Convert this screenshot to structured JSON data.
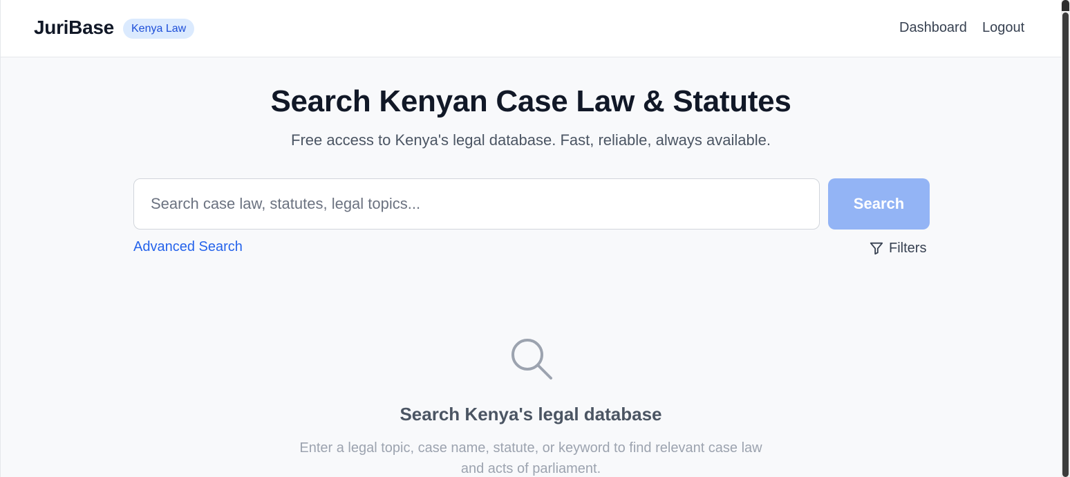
{
  "header": {
    "brand": "JuriBase",
    "badge": "Kenya Law",
    "nav": {
      "dashboard": "Dashboard",
      "logout": "Logout"
    }
  },
  "hero": {
    "title": "Search Kenyan Case Law & Statutes",
    "subtitle": "Free access to Kenya's legal database. Fast, reliable, always available."
  },
  "search": {
    "placeholder": "Search case law, statutes, legal topics...",
    "value": "",
    "button_label": "Search",
    "button_color": "#93b4f5",
    "advanced_label": "Advanced Search",
    "filters_label": "Filters",
    "filters_icon": "filter-funnel-icon"
  },
  "empty_state": {
    "icon": "search-magnifier-icon",
    "title": "Search Kenya's legal database",
    "description": "Enter a legal topic, case name, statute, or keyword to find relevant case law and acts of parliament."
  },
  "colors": {
    "accent": "#2563eb",
    "badge_bg": "#dbeafe",
    "page_bg": "#f8f9fb"
  }
}
